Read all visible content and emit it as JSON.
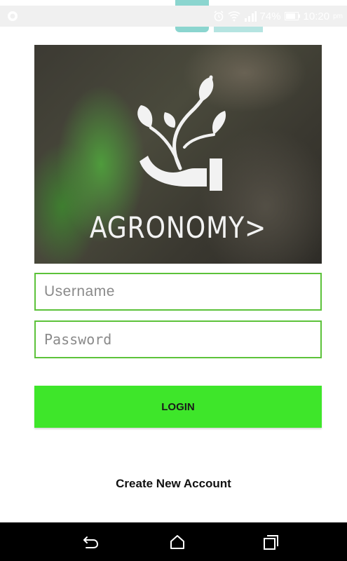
{
  "status_bar": {
    "battery": "74%",
    "time": "10:20",
    "ampm": "pm",
    "icons": [
      "app-icon",
      "alarm-icon",
      "wifi-icon",
      "signal-icon",
      "battery-icon"
    ]
  },
  "hero": {
    "logo_text": "AGRONOMY>",
    "logo_icon": "plant-in-hand-icon"
  },
  "form": {
    "username_placeholder": "Username",
    "password_placeholder": "Password",
    "login_label": "LOGIN",
    "create_account_label": "Create New Account"
  },
  "colors": {
    "accent": "#3ee62a",
    "field_border": "#5cc23a",
    "nav_bar": "#000000"
  },
  "nav_bar": {
    "buttons": [
      "back-icon",
      "home-icon",
      "recent-apps-icon"
    ]
  }
}
